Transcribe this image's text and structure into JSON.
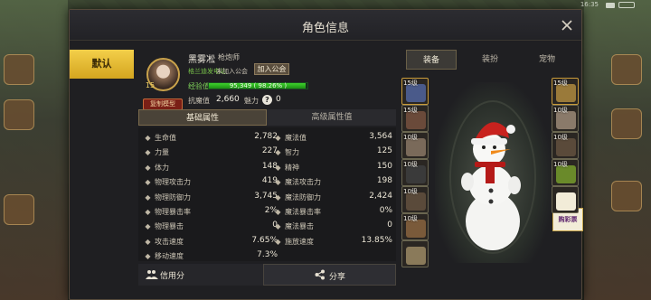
{
  "status_bar": {
    "time": "16:35"
  },
  "window": {
    "title": "角色信息"
  },
  "preset": {
    "label": "默认"
  },
  "profile": {
    "name": "黑雾凇",
    "class": "枪炮师",
    "level": "15",
    "title_badge": "复制模型",
    "server": "格兰迪发电站",
    "guild_status": "未加入公会",
    "join_guild_label": "加入公会",
    "exp_label": "经验值",
    "exp_text": "95,349 ( 98.26% )",
    "exp_percent": 98.26,
    "resistance_label": "抗魔值",
    "resistance_value": "2,660",
    "charm_label": "魅力",
    "charm_help": "?",
    "charm_value": "0"
  },
  "attr_tabs": {
    "basic": "基础属性",
    "advanced": "高级属性值"
  },
  "stats": [
    {
      "left": {
        "icon": "heart-icon",
        "name": "生命值",
        "value": "2,782"
      },
      "right": {
        "icon": "mana-icon",
        "name": "魔法值",
        "value": "3,564"
      }
    },
    {
      "left": {
        "icon": "fist-icon",
        "name": "力量",
        "value": "227"
      },
      "right": {
        "icon": "brain-icon",
        "name": "智力",
        "value": "125"
      }
    },
    {
      "left": {
        "icon": "body-icon",
        "name": "体力",
        "value": "148"
      },
      "right": {
        "icon": "spirit-icon",
        "name": "精神",
        "value": "150"
      }
    },
    {
      "left": {
        "icon": "sword-icon",
        "name": "物理攻击力",
        "value": "419"
      },
      "right": {
        "icon": "staff-icon",
        "name": "魔法攻击力",
        "value": "198"
      }
    },
    {
      "left": {
        "icon": "shield-icon",
        "name": "物理防御力",
        "value": "3,745"
      },
      "right": {
        "icon": "magic-shield-icon",
        "name": "魔法防御力",
        "value": "2,424"
      }
    },
    {
      "left": {
        "icon": "crit-icon",
        "name": "物理暴击率",
        "value": "2%"
      },
      "right": {
        "icon": "magic-crit-icon",
        "name": "魔法暴击率",
        "value": "0%"
      }
    },
    {
      "left": {
        "icon": "crit-damage-icon",
        "name": "物理暴击",
        "value": "0"
      },
      "right": {
        "icon": "magic-crit-damage-icon",
        "name": "魔法暴击",
        "value": "0"
      }
    },
    {
      "left": {
        "icon": "attack-speed-icon",
        "name": "攻击速度",
        "value": "7.65%"
      },
      "right": {
        "icon": "cast-speed-icon",
        "name": "施放速度",
        "value": "13.85%"
      }
    },
    {
      "left": {
        "icon": "move-speed-icon",
        "name": "移动速度",
        "value": "7.3%"
      },
      "right": null
    }
  ],
  "bottom": {
    "credit_label": "信用分",
    "share_label": "分享"
  },
  "equip_tabs": {
    "equipment": "装备",
    "avatar": "装扮",
    "pet": "宠物"
  },
  "left_slots": [
    {
      "level": "15级",
      "color": "#4a5a8a"
    },
    {
      "level": "15级",
      "color": "#6a4a3a"
    },
    {
      "level": "10级",
      "color": "#7a6a5a"
    },
    {
      "level": "10级",
      "color": "#3a3a3a"
    },
    {
      "level": "10级",
      "color": "#5a4a3a"
    },
    {
      "level": "10级",
      "color": "#7a5a3a"
    },
    {
      "level": "",
      "color": "#8a7a5a"
    }
  ],
  "right_slots": [
    {
      "level": "15级",
      "color": "#9a7a3a"
    },
    {
      "level": "10级",
      "color": "#8a7a6a"
    },
    {
      "level": "10级",
      "color": "#5a4a3a"
    },
    {
      "level": "10级",
      "color": "#6a8a2a"
    },
    {
      "level": "",
      "color": "#f2ecd8"
    }
  ],
  "card_logo": "购彩票",
  "colors": {
    "accent_gold": "#d4a51f",
    "exp_green": "#3ed22c",
    "panel_bg": "#1f1f22"
  }
}
